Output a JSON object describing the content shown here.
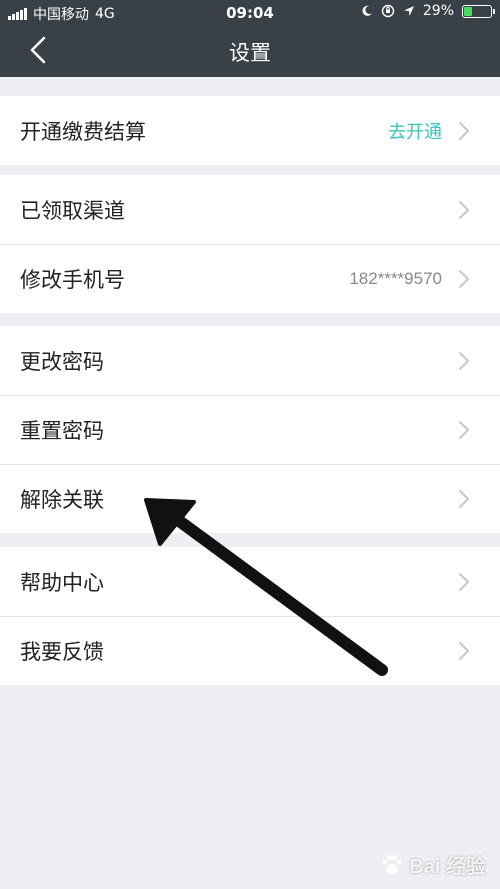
{
  "status_bar": {
    "carrier": "中国移动",
    "network": "4G",
    "time": "09:04",
    "battery_percent": "29%",
    "battery_level": 0.29,
    "icons": [
      "signal-icon",
      "moon-icon",
      "orientation-lock-icon",
      "location-icon",
      "battery-icon"
    ]
  },
  "nav": {
    "title": "设置",
    "back_icon": "chevron-left-icon"
  },
  "groups": [
    {
      "items": [
        {
          "label": "开通缴费结算",
          "value": "去开通"
        }
      ]
    },
    {
      "items": [
        {
          "label": "已领取渠道",
          "value": ""
        },
        {
          "label": "修改手机号",
          "value": "182****9570"
        }
      ]
    },
    {
      "items": [
        {
          "label": "更改密码",
          "value": ""
        },
        {
          "label": "重置密码",
          "value": ""
        },
        {
          "label": "解除关联",
          "value": ""
        }
      ]
    },
    {
      "items": [
        {
          "label": "帮助中心",
          "value": ""
        },
        {
          "label": "我要反馈",
          "value": ""
        }
      ]
    }
  ],
  "colors": {
    "header_bg": "#394047",
    "page_bg": "#efeef3",
    "accent": "#39c4b7",
    "annotation_arrow": "#111111"
  },
  "watermark": {
    "text": "Bai 经验",
    "icon": "paw-icon"
  }
}
